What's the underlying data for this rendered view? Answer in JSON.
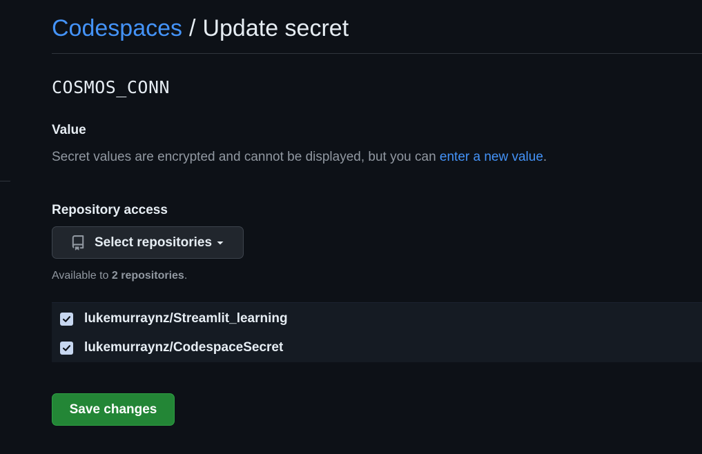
{
  "colors": {
    "background": "#0d1117",
    "link": "#4493f8",
    "muted": "#9198a1",
    "primary_button": "#238636",
    "list_background": "#151b23",
    "checkbox": "#c7d7f0"
  },
  "header": {
    "breadcrumb_link": "Codespaces",
    "separator": "/",
    "title": "Update secret"
  },
  "secret": {
    "name": "COSMOS_CONN"
  },
  "value_section": {
    "label": "Value",
    "description": "Secret values are encrypted and cannot be displayed, but you can ",
    "link_text": "enter a new value",
    "trailing": "."
  },
  "access_section": {
    "label": "Repository access",
    "select_button": {
      "icon": "repo-icon",
      "label": "Select repositories",
      "caret_icon": "triangle-down-icon"
    },
    "available": {
      "prefix": "Available to ",
      "count_text": "2 repositories",
      "suffix": "."
    },
    "repositories": [
      {
        "name": "lukemurraynz/Streamlit_learning",
        "checked": true
      },
      {
        "name": "lukemurraynz/CodespaceSecret",
        "checked": true
      }
    ]
  },
  "actions": {
    "save_label": "Save changes"
  }
}
